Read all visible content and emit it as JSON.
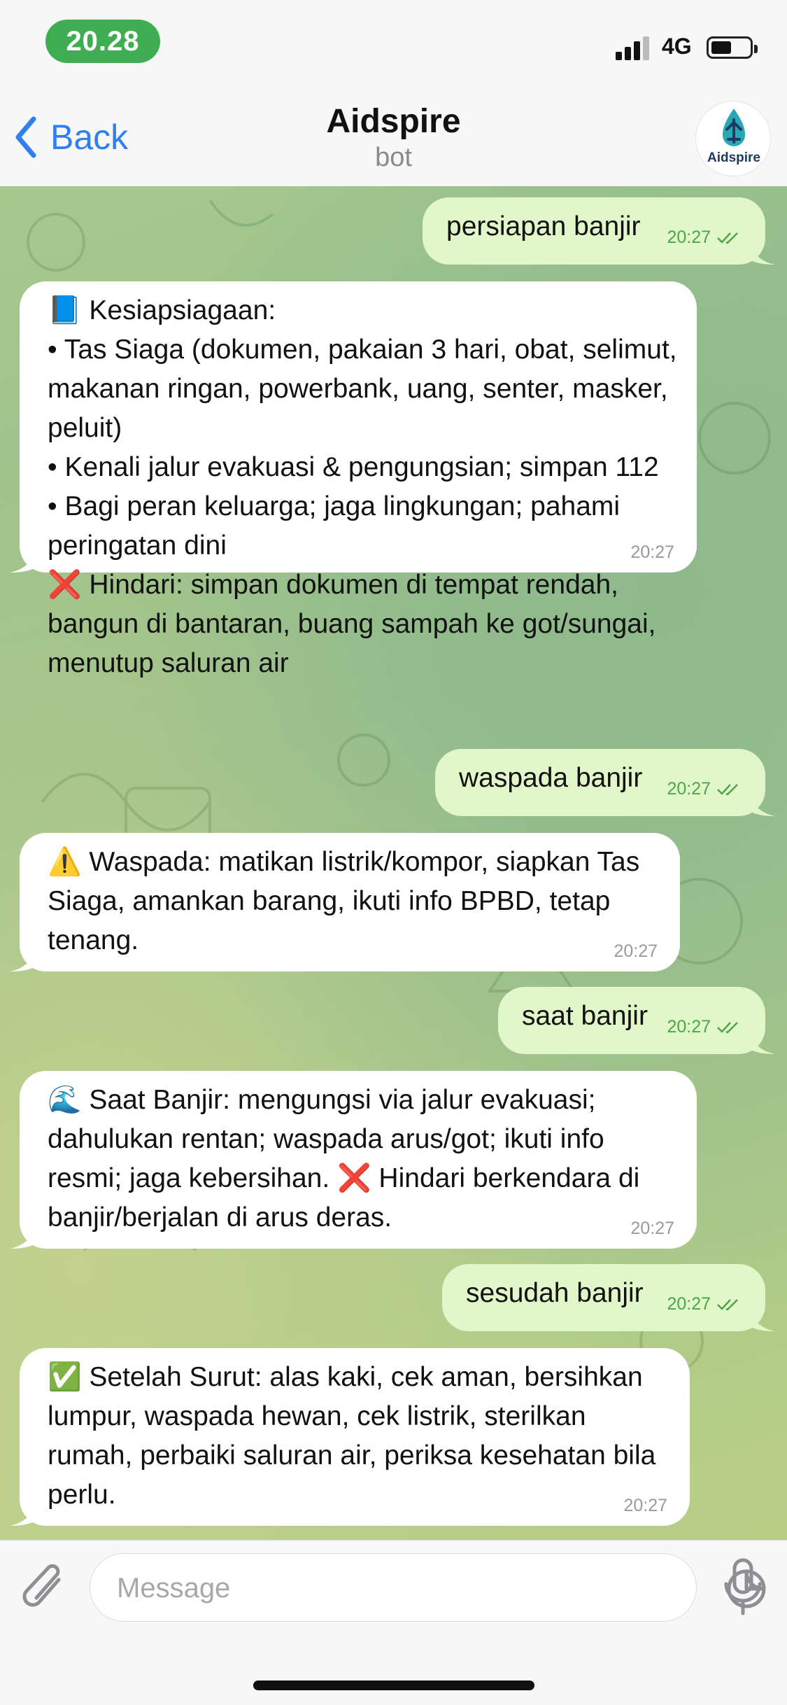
{
  "status_bar": {
    "time": "20.28",
    "network": "4G"
  },
  "header": {
    "back_label": "Back",
    "title": "Aidspire",
    "subtitle": "bot",
    "avatar_label": "Aidspire"
  },
  "messages": [
    {
      "text": "persiapan banjir",
      "time": "20:27"
    },
    {
      "text": "📘 Kesiapsiagaan:\n• Tas Siaga (dokumen, pakaian 3 hari, obat, selimut, makanan ringan, powerbank, uang, senter, masker, peluit)\n• Kenali jalur evakuasi & pengungsian; simpan 112\n• Bagi peran keluarga; jaga lingkungan; pahami peringatan dini\n❌ Hindari: simpan dokumen di tempat rendah, bangun di bantaran, buang sampah ke got/sungai, menutup saluran air",
      "time": "20:27"
    },
    {
      "text": "waspada banjir",
      "time": "20:27"
    },
    {
      "text": "⚠️ Waspada: matikan listrik/kompor, siapkan Tas Siaga, amankan barang, ikuti info BPBD, tetap tenang.",
      "time": "20:27"
    },
    {
      "text": "saat banjir",
      "time": "20:27"
    },
    {
      "text": "🌊 Saat Banjir: mengungsi via jalur evakuasi; dahulukan rentan; waspada arus/got; ikuti info resmi; jaga kebersihan. ❌ Hindari berkendara di banjir/berjalan di arus deras.",
      "time": "20:27"
    },
    {
      "text": "sesudah banjir",
      "time": "20:27"
    },
    {
      "text": "✅ Setelah Surut: alas kaki, cek aman, bersihkan lumpur, waspada hewan, cek listrik, sterilkan rumah, perbaiki saluran air, periksa kesehatan bila perlu.",
      "time": "20:27"
    }
  ],
  "composer": {
    "placeholder": "Message"
  },
  "colors": {
    "accent": "#2f7ff2",
    "outgoing_bubble": "#e2f7c9",
    "incoming_bubble": "#ffffff",
    "time_pill": "#3fae52",
    "read_ticks": "#4da54a"
  },
  "icons": {
    "back": "chevron-left-icon",
    "attach": "paperclip-icon",
    "sticker": "sticker-icon",
    "mic": "microphone-icon",
    "read": "double-check-icon"
  }
}
